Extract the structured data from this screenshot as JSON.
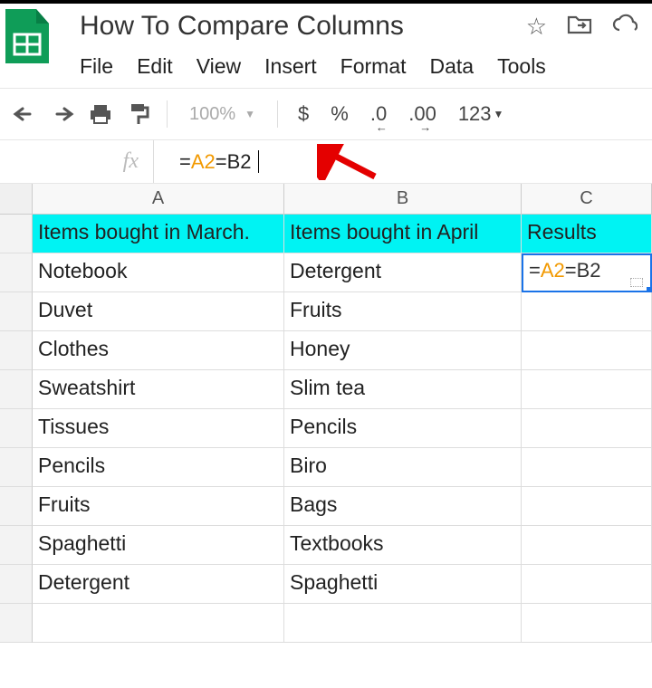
{
  "header": {
    "title": "How To Compare Columns",
    "menu": [
      "File",
      "Edit",
      "View",
      "Insert",
      "Format",
      "Data",
      "Tools"
    ]
  },
  "toolbar": {
    "zoom": "100%",
    "currency": "$",
    "percent": "%",
    "dec_less": ".0",
    "dec_more": ".00",
    "num_format": "123"
  },
  "formula_bar": {
    "fx": "fx",
    "eq": "=",
    "ref1": "A2",
    "mid": "=B2"
  },
  "columns": [
    "A",
    "B",
    "C"
  ],
  "header_row": {
    "A": "Items bought in March.",
    "B": "Items bought in April",
    "C": "Results"
  },
  "rows": [
    {
      "A": "Notebook",
      "B": "Detergent",
      "C": ""
    },
    {
      "A": "Duvet",
      "B": "Fruits",
      "C": ""
    },
    {
      "A": "Clothes",
      "B": "Honey",
      "C": ""
    },
    {
      "A": "Sweatshirt",
      "B": "Slim tea",
      "C": ""
    },
    {
      "A": "Tissues",
      "B": "Pencils",
      "C": ""
    },
    {
      "A": "Pencils",
      "B": "Biro",
      "C": ""
    },
    {
      "A": "Fruits",
      "B": "Bags",
      "C": ""
    },
    {
      "A": "Spaghetti",
      "B": "Textbooks",
      "C": ""
    },
    {
      "A": "Detergent",
      "B": "Spaghetti",
      "C": ""
    },
    {
      "A": "",
      "B": "",
      "C": ""
    }
  ],
  "active_cell": {
    "eq": "=",
    "ref1": "A2",
    "rest": "=B2"
  }
}
